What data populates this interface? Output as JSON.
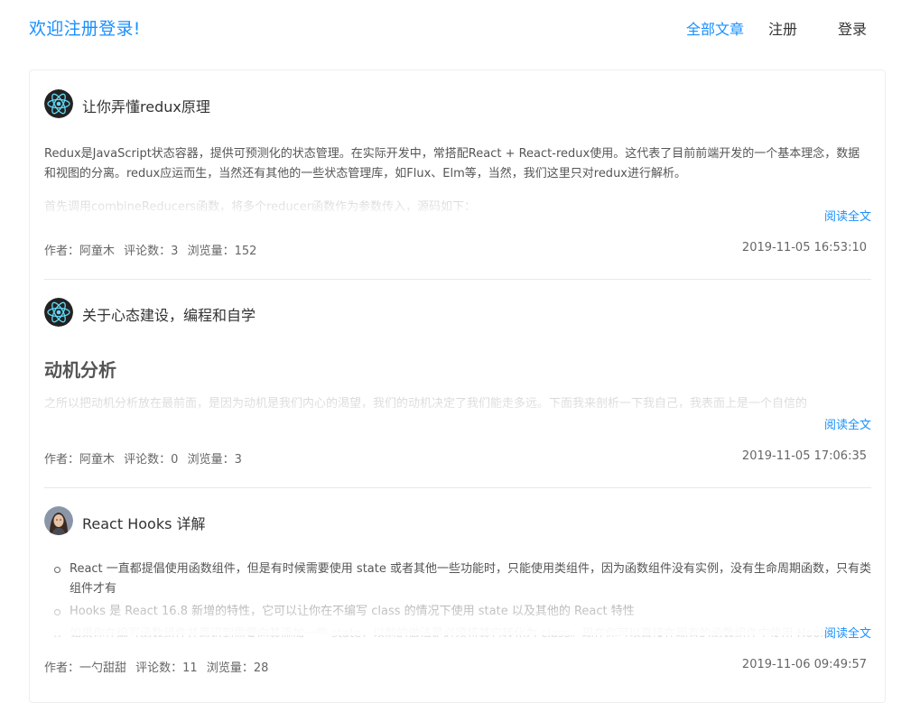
{
  "header": {
    "brand": "欢迎注册登录!",
    "nav": {
      "all_articles": "全部文章",
      "register": "注册",
      "login": "登录"
    }
  },
  "colors": {
    "accent": "#1890ff",
    "text": "#333333",
    "muted": "#666666"
  },
  "articles": [
    {
      "avatar_icon": "react-logo-icon",
      "title": "让你弄懂redux原理",
      "summary": {
        "p1": "Redux是JavaScript状态容器，提供可预测化的状态管理。在实际开发中，常搭配React + React-redux使用。这代表了目前前端开发的一个基本理念，数据和视图的分离。redux应运而生，当然还有其他的一些状态管理库，如Flux、Elm等，当然，我们这里只对redux进行解析。",
        "p2": "首先调用combineReducers函数，将多个reducer函数作为参数传入，源码如下："
      },
      "read_more": "阅读全文",
      "meta": {
        "author": "作者：阿童木",
        "comments": "评论数：3",
        "views": "浏览量：152"
      },
      "date": "2019-11-05 16:53:10"
    },
    {
      "avatar_icon": "react-logo-icon",
      "title": "关于心态建设，编程和自学",
      "summary": {
        "heading": "动机分析",
        "p1": "之所以把动机分析放在最前面，是因为动机是我们内心的渴望，我们的动机决定了我们能走多远。下面我来剖析一下我自己，我表面上是一个自信的"
      },
      "read_more": "阅读全文",
      "meta": {
        "author": "作者：阿童木",
        "comments": "评论数：0",
        "views": "浏览量：3"
      },
      "date": "2019-11-05 17:06:35"
    },
    {
      "avatar_icon": "user-photo-avatar",
      "title": "React Hooks 详解",
      "summary": {
        "items": [
          "React 一直都提倡使用函数组件，但是有时候需要使用 state 或者其他一些功能时，只能使用类组件，因为函数组件没有实例，没有生命周期函数，只有类组件才有",
          "Hooks 是 React 16.8 新增的特性，它可以让你在不编写 class 的情况下使用 state 以及其他的 React 特性",
          "如果你在编写函数组件并意识到需要向其添加一些 state，以前的做法是必须将其它转化为 class。现在你可以直接在现有的函数组件中使用 Hooks"
        ]
      },
      "read_more": "阅读全文",
      "meta": {
        "author": "作者：一勺甜甜",
        "comments": "评论数：11",
        "views": "浏览量：28"
      },
      "date": "2019-11-06 09:49:57"
    }
  ]
}
